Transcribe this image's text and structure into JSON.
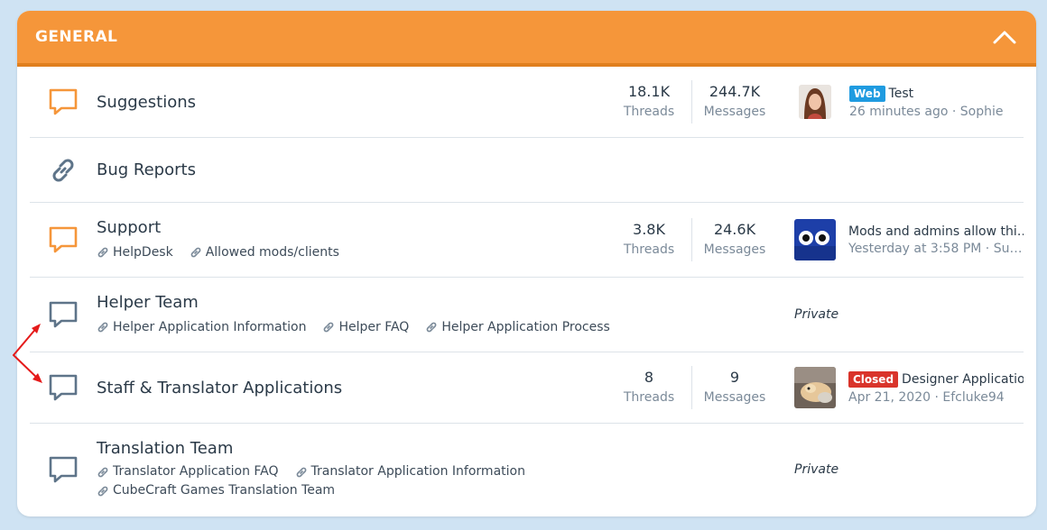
{
  "section": {
    "title": "GENERAL"
  },
  "colors": {
    "header": "#f5963a",
    "accent_icon": "#f5963a",
    "muted_icon": "#5e7489",
    "badge_web": "#1f9be0",
    "badge_closed": "#d9342b"
  },
  "forums": [
    {
      "title": "Suggestions",
      "icon": "chat-bubble-icon",
      "threads": "18.1K",
      "threads_label": "Threads",
      "messages": "244.7K",
      "messages_label": "Messages",
      "latest": {
        "badge": "Web",
        "title": "Test",
        "time": "26 minutes ago",
        "user": "Sophie",
        "meta": "26 minutes ago · Sophie"
      }
    },
    {
      "title": "Bug Reports",
      "icon": "link-icon"
    },
    {
      "title": "Support",
      "icon": "chat-bubble-icon",
      "subforums": [
        "HelpDesk",
        "Allowed mods/clients"
      ],
      "threads": "3.8K",
      "threads_label": "Threads",
      "messages": "24.6K",
      "messages_label": "Messages",
      "latest": {
        "title": "Mods and admins allow thi…",
        "meta": "Yesterday at 3:58 PM · Sum…"
      }
    },
    {
      "title": "Helper Team",
      "icon": "chat-bubble-icon",
      "subforums": [
        "Helper Application Information",
        "Helper FAQ",
        "Helper Application Process"
      ],
      "private_label": "Private"
    },
    {
      "title": "Staff & Translator Applications",
      "icon": "chat-bubble-icon",
      "threads": "8",
      "threads_label": "Threads",
      "messages": "9",
      "messages_label": "Messages",
      "latest": {
        "badge": "Closed",
        "title": "Designer Applicatio…",
        "meta": "Apr 21, 2020 · Efcluke94"
      }
    },
    {
      "title": "Translation Team",
      "icon": "chat-bubble-icon",
      "subforums": [
        "Translator Application FAQ",
        "Translator Application Information",
        "CubeCraft Games Translation Team"
      ],
      "private_label": "Private"
    }
  ]
}
